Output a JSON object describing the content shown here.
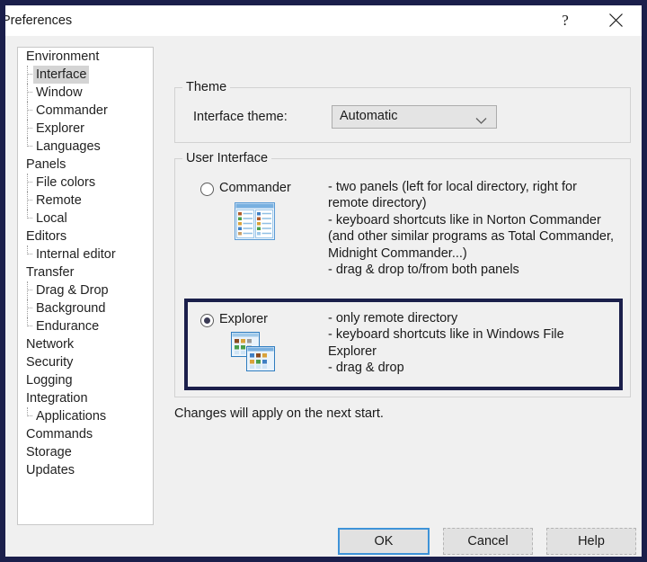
{
  "window": {
    "title": "Preferences",
    "help_icon": "question-mark-icon",
    "close_icon": "close-icon",
    "border_color": "#1b1f4b"
  },
  "sidebar": {
    "name": "preferences-category-tree",
    "items": [
      {
        "label": "Environment",
        "level": 0,
        "selected": false
      },
      {
        "label": "Interface",
        "level": 1,
        "selected": true
      },
      {
        "label": "Window",
        "level": 1,
        "selected": false
      },
      {
        "label": "Commander",
        "level": 1,
        "selected": false
      },
      {
        "label": "Explorer",
        "level": 1,
        "selected": false
      },
      {
        "label": "Languages",
        "level": 1,
        "selected": false
      },
      {
        "label": "Panels",
        "level": 0,
        "selected": false
      },
      {
        "label": "File colors",
        "level": 1,
        "selected": false
      },
      {
        "label": "Remote",
        "level": 1,
        "selected": false
      },
      {
        "label": "Local",
        "level": 1,
        "selected": false
      },
      {
        "label": "Editors",
        "level": 0,
        "selected": false
      },
      {
        "label": "Internal editor",
        "level": 1,
        "selected": false
      },
      {
        "label": "Transfer",
        "level": 0,
        "selected": false
      },
      {
        "label": "Drag & Drop",
        "level": 1,
        "selected": false
      },
      {
        "label": "Background",
        "level": 1,
        "selected": false
      },
      {
        "label": "Endurance",
        "level": 1,
        "selected": false
      },
      {
        "label": "Network",
        "level": 0,
        "selected": false
      },
      {
        "label": "Security",
        "level": 0,
        "selected": false
      },
      {
        "label": "Logging",
        "level": 0,
        "selected": false
      },
      {
        "label": "Integration",
        "level": 0,
        "selected": false
      },
      {
        "label": "Applications",
        "level": 1,
        "selected": false
      },
      {
        "label": "Commands",
        "level": 0,
        "selected": false
      },
      {
        "label": "Storage",
        "level": 0,
        "selected": false
      },
      {
        "label": "Updates",
        "level": 0,
        "selected": false
      }
    ]
  },
  "theme": {
    "group_title": "Theme",
    "label": "Interface theme:",
    "selected": "Automatic",
    "options": [
      "Automatic"
    ]
  },
  "user_interface": {
    "group_title": "User Interface",
    "commander": {
      "label": "Commander",
      "checked": false,
      "icon": "two-panel-window-icon",
      "description": "- two panels (left for local directory, right for remote directory)\n- keyboard shortcuts like in Norton Commander (and other similar programs as Total Commander, Midnight Commander...)\n- drag & drop to/from both panels"
    },
    "explorer": {
      "label": "Explorer",
      "checked": true,
      "icon": "two-stacked-windows-icon",
      "description": "- only remote directory\n- keyboard shortcuts like in Windows File Explorer\n- drag & drop",
      "highlight_color": "#1b1f4b"
    }
  },
  "note": "Changes will apply on the next start.",
  "buttons": {
    "ok": "OK",
    "cancel": "Cancel",
    "help": "Help",
    "focus_color": "#3e93d8"
  }
}
